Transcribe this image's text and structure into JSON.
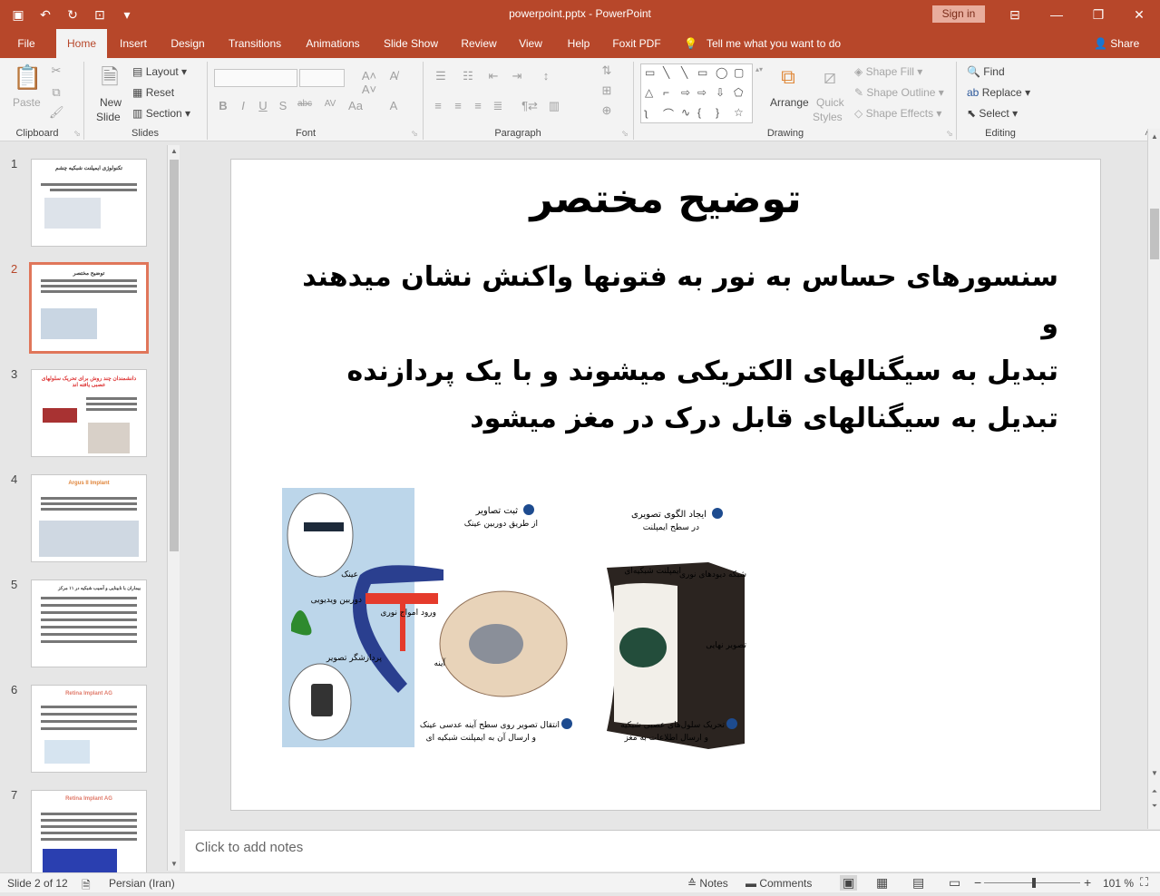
{
  "app": {
    "doc_title": "powerpoint.pptx  -  PowerPoint",
    "signin_label": "Sign in"
  },
  "tabs": [
    "File",
    "Home",
    "Insert",
    "Design",
    "Transitions",
    "Animations",
    "Slide Show",
    "Review",
    "View",
    "Help",
    "Foxit PDF"
  ],
  "tell_me": "Tell me what you want to do",
  "share_label": "Share",
  "ribbon": {
    "clipboard": {
      "paste": "Paste",
      "label": "Clipboard"
    },
    "slides": {
      "new_slide_1": "New",
      "new_slide_2": "Slide",
      "layout": "Layout",
      "reset": "Reset",
      "section": "Section",
      "label": "Slides"
    },
    "font": {
      "label": "Font"
    },
    "paragraph": {
      "label": "Paragraph"
    },
    "drawing": {
      "arrange": "Arrange",
      "quick_styles_1": "Quick",
      "quick_styles_2": "Styles",
      "shape_fill": "Shape Fill",
      "shape_outline": "Shape Outline",
      "shape_effects": "Shape Effects",
      "label": "Drawing"
    },
    "editing": {
      "find": "Find",
      "replace": "Replace",
      "select": "Select",
      "label": "Editing"
    }
  },
  "thumbnails": [
    {
      "num": "1",
      "title": "تکنولوژی ایمپلنت شبکیه چشم",
      "title_red": false
    },
    {
      "num": "2",
      "title": "توضیح مختصر",
      "title_red": false
    },
    {
      "num": "3",
      "title": "دانشمندان چند روش برای تحریک سلولهای عصبی یافته اند",
      "title_red": true
    },
    {
      "num": "4",
      "title": "Argus II Implant",
      "title_red": true
    },
    {
      "num": "5",
      "title": "بیماران با نابینایی و آسیب شبکیه در ۱۱ مرکز",
      "title_red": false
    },
    {
      "num": "6",
      "title": "Retina Implant AG",
      "title_red": true
    },
    {
      "num": "7",
      "title": "Retina Implant AG",
      "title_red": true
    }
  ],
  "slide": {
    "title": "توضیح مختصر",
    "body_lines": [
      "سنسورهای حساس به نور به فتونها واکنش نشان میدهند و",
      "تبدیل به سیگنالهای الکتریکی میشوند و با یک پردازنده",
      "تبدیل به سیگنالهای قابل درک در مغز میشود"
    ],
    "figure_labels": {
      "step1": "ثبت تصاویر",
      "step1b": "از طریق دوربین عینک",
      "step2": "ایجاد الگوی تصویری",
      "step2b": "در سطح ایمپلنت",
      "glasses": "عینک",
      "camera": "دوربین ویدیویی",
      "processor": "پردازشگر تصویر",
      "mirror": "آینه",
      "light": "ورود امواج نوری",
      "implant": "ایمپلنت شبکیه‌ای",
      "retina": "شبکه دیودهای نوری",
      "image": "تصویر نهایی",
      "step3": "انتقال تصویر روی سطح آینه عدسی عینک",
      "step3b": "و ارسال آن به ایمپلنت شبکیه ای",
      "step4": "تحریک سلول‌های عصبی شبکیه",
      "step4b": "و ارسال اطلاعات به مغز"
    }
  },
  "notes_placeholder": "Click to add notes",
  "status": {
    "slide_of": "Slide 2 of 12",
    "language": "Persian (Iran)",
    "notes": "Notes",
    "comments": "Comments",
    "zoom": "101 %"
  },
  "colors": {
    "accent": "#b7472a",
    "thumb_sel": "#e0765a"
  }
}
